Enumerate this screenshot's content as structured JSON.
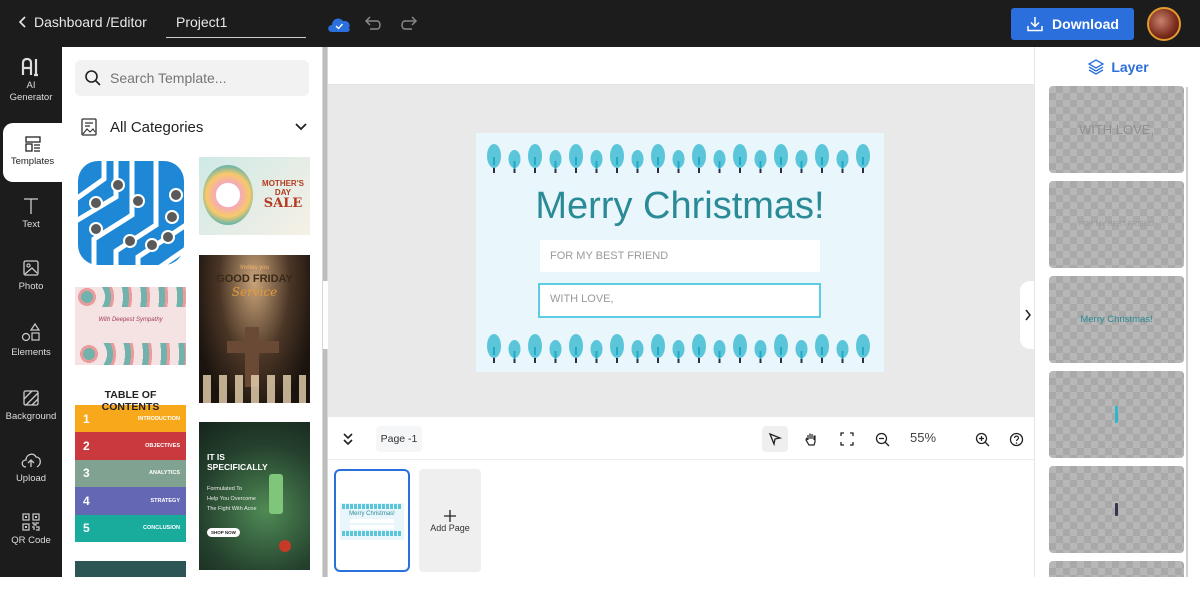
{
  "topbar": {
    "breadcrumb": "Dashboard /Editor",
    "project_name": "Project1",
    "download_label": "Download"
  },
  "leftnav": {
    "items": [
      {
        "label": "AI",
        "label2": "Generator",
        "icon": "ai-icon"
      },
      {
        "label": "Templates",
        "icon": "templates-icon"
      },
      {
        "label": "Text",
        "icon": "text-icon"
      },
      {
        "label": "Photo",
        "icon": "photo-icon"
      },
      {
        "label": "Elements",
        "icon": "elements-icon"
      },
      {
        "label": "Background",
        "icon": "background-icon"
      },
      {
        "label": "Upload",
        "icon": "upload-icon"
      },
      {
        "label": "QR Code",
        "icon": "qr-code-icon"
      }
    ],
    "active": "Templates"
  },
  "templates": {
    "search_placeholder": "Search Template...",
    "category": "All Categories",
    "items": [
      {
        "name": "circuit-logo"
      },
      {
        "name": "mothers-day-sale",
        "text": [
          "MOTHER'S DAY",
          "SALE"
        ]
      },
      {
        "name": "sympathy-card",
        "text": [
          "With Deepest Sympathy"
        ]
      },
      {
        "name": "good-friday",
        "text": [
          "Invites you",
          "GOOD FRIDAY",
          "Service"
        ]
      },
      {
        "name": "table-of-contents",
        "title": "TABLE OF CONTENTS",
        "rows": [
          {
            "num": "1",
            "label": "INTRODUCTION",
            "color": "#f7a81b"
          },
          {
            "num": "2",
            "label": "OBJECTIVES",
            "color": "#c9393e"
          },
          {
            "num": "3",
            "label": "ANALYTICS",
            "color": "#7fa291"
          },
          {
            "num": "4",
            "label": "STRATEGY",
            "color": "#6367b4"
          },
          {
            "num": "5",
            "label": "CONCLUSION",
            "color": "#19ab9c"
          }
        ]
      },
      {
        "name": "acne-product",
        "text": [
          "IT IS",
          "SPECIFICALLY",
          "Formulated To",
          "Help You Overcome",
          "The Fight With Acne",
          "SHOP NOW"
        ]
      }
    ]
  },
  "card": {
    "title": "Merry Christmas!",
    "field1": "FOR MY BEST FRIEND",
    "field2": "WITH LOVE,",
    "title_color": "#2a8b97",
    "bg_color": "#e9f6fc",
    "tree_color": "#5bc5da"
  },
  "toolbar": {
    "page_label": "Page -1",
    "zoom": "55%"
  },
  "pages": {
    "thumb_title": "Merry Christmas!",
    "add_label": "Add Page"
  },
  "layers": {
    "title": "Layer",
    "items": [
      {
        "text": "WITH LOVE,"
      },
      {
        "text": "FOR MY BEST FRIEND"
      },
      {
        "text": "Merry Christmas!"
      },
      {
        "text": "",
        "shape": "cyan-bar"
      },
      {
        "text": "",
        "shape": "dark-bar"
      }
    ]
  }
}
